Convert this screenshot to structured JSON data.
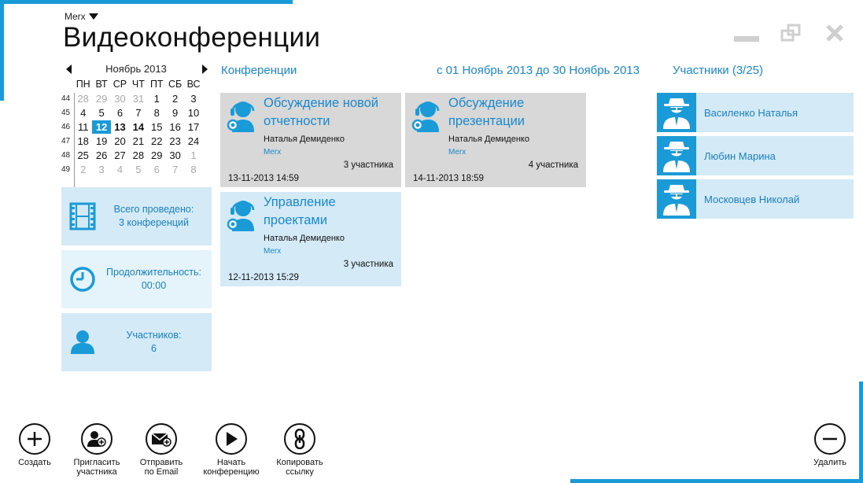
{
  "colors": {
    "accent": "#1a9ad6",
    "tile_blue": "#d4eaf6",
    "tile_gray": "#d8d8d8",
    "link": "#1a88cc"
  },
  "header": {
    "user_menu": "Merx",
    "title": "Видеоконференции"
  },
  "calendar": {
    "month_label": "Ноябрь 2013",
    "weekdays": [
      "ПН",
      "ВТ",
      "СР",
      "ЧТ",
      "ПТ",
      "СБ",
      "ВС"
    ],
    "weeks": [
      {
        "num": "44",
        "days": [
          "28",
          "29",
          "30",
          "31",
          "1",
          "2",
          "3"
        ]
      },
      {
        "num": "45",
        "days": [
          "4",
          "5",
          "6",
          "7",
          "8",
          "9",
          "10"
        ]
      },
      {
        "num": "46",
        "days": [
          "11",
          "12",
          "13",
          "14",
          "15",
          "16",
          "17"
        ]
      },
      {
        "num": "47",
        "days": [
          "18",
          "19",
          "20",
          "21",
          "22",
          "23",
          "24"
        ]
      },
      {
        "num": "48",
        "days": [
          "25",
          "26",
          "27",
          "28",
          "29",
          "30",
          "1"
        ]
      },
      {
        "num": "49",
        "days": [
          "2",
          "3",
          "4",
          "5",
          "6",
          "7",
          "8"
        ]
      }
    ],
    "today": "12",
    "bold_days": [
      "13",
      "14"
    ]
  },
  "stats": {
    "total": {
      "label": "Всего проведено:",
      "value": "3 конференций"
    },
    "duration": {
      "label": "Продолжительность:",
      "value": "00:00"
    },
    "participants": {
      "label": "Участников:",
      "value": "6"
    }
  },
  "nav": {
    "conferences_label": "Конференции",
    "date_range": "с 01 Ноябрь 2013 до 30 Ноябрь 2013",
    "participants_label": "Участники (3/25)"
  },
  "conferences": [
    {
      "title": "Обсуждение новой отчетности",
      "owner": "Наталья Демиденко",
      "org": "Merx",
      "participants": "3 участника",
      "date": "13-11-2013 14:59"
    },
    {
      "title": "Обсуждение презентации",
      "owner": "Наталья Демиденко",
      "org": "Merx",
      "participants": "4 участника",
      "date": "14-11-2013 18:59"
    },
    {
      "title": "Управление проектами",
      "owner": "Наталья Демиденко",
      "org": "Merx",
      "participants": "3 участника",
      "date": "12-11-2013 15:29"
    }
  ],
  "participants": [
    {
      "name": "Василенко Наталья"
    },
    {
      "name": "Любин Марина"
    },
    {
      "name": "Московцев Николай"
    }
  ],
  "toolbar": {
    "create": "Создать",
    "invite": "Пригласить\nучастника",
    "email": "Отправить\nпо Email",
    "start": "Начать\nконференцию",
    "copy": "Копировать\nссылку",
    "delete": "Удалить"
  }
}
